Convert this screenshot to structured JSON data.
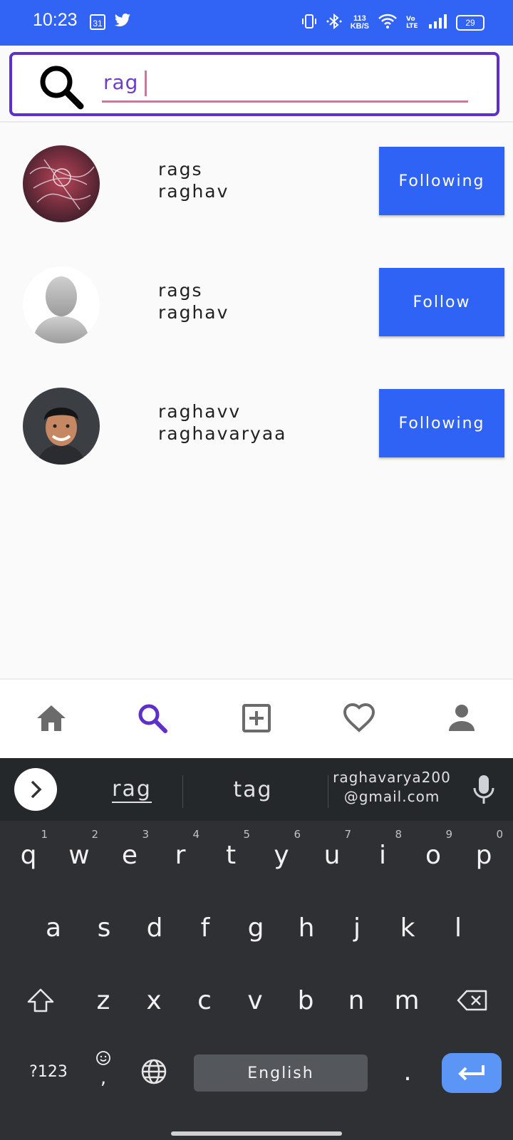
{
  "status_bar": {
    "time": "10:23",
    "calendar_day": "31",
    "net_speed_value": "113",
    "net_speed_unit": "KB/S",
    "volte": "Vo LTE",
    "battery": "29",
    "background_color": "#3164f5"
  },
  "search": {
    "value": "rag",
    "border_color": "#5e2fc9",
    "underline_color": "#e8679d"
  },
  "users": [
    {
      "username": "rags",
      "name": "raghav",
      "button_label": "Following",
      "avatar": "artwork-avatar"
    },
    {
      "username": "rags",
      "name": "raghav",
      "button_label": "Follow",
      "avatar": "default-avatar"
    },
    {
      "username": "raghavv",
      "name": "raghavaryaa",
      "button_label": "Following",
      "avatar": "photo-avatar"
    }
  ],
  "button_color": "#2f63f5",
  "bottom_nav": {
    "items": [
      "home-icon",
      "search-icon",
      "add-post-icon",
      "heart-icon",
      "profile-icon"
    ],
    "active": "search-icon",
    "active_color": "#5e2fc9",
    "inactive_color": "#6b6b6b"
  },
  "keyboard": {
    "suggestions": [
      "rag",
      "tag"
    ],
    "email_suggestion_line1": "raghavarya200",
    "email_suggestion_line2": "@gmail.com",
    "row1": [
      "q",
      "w",
      "e",
      "r",
      "t",
      "y",
      "u",
      "i",
      "o",
      "p"
    ],
    "row1_hints": [
      "1",
      "2",
      "3",
      "4",
      "5",
      "6",
      "7",
      "8",
      "9",
      "0"
    ],
    "row2": [
      "a",
      "s",
      "d",
      "f",
      "g",
      "h",
      "j",
      "k",
      "l"
    ],
    "row3": [
      "z",
      "x",
      "c",
      "v",
      "b",
      "n",
      "m"
    ],
    "symbols_label": "?123",
    "comma_label": ",",
    "space_label": "English",
    "period_label": "."
  }
}
